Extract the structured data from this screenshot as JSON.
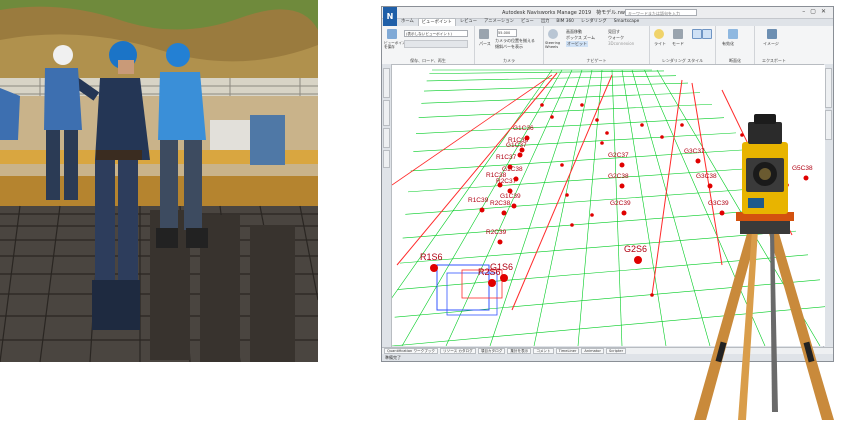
{
  "window": {
    "title": "Autodesk Navisworks Manage 2019　荷モデル.nwd",
    "search_placeholder": "キーワードまたは語句を入力",
    "app_button": "N"
  },
  "tabs": [
    "ホーム",
    "ビューポイント",
    "レビュー",
    "アニメーション",
    "ビュー",
    "出力",
    "BIM 360",
    "レンダリング",
    "Smartscape"
  ],
  "active_tab": "ビューポイント",
  "ribbon": {
    "groups": [
      {
        "id": "save-load",
        "label": "保存、ロード、再生"
      },
      {
        "id": "camera",
        "label": "カメラ"
      },
      {
        "id": "navigate",
        "label": "ナビゲート"
      },
      {
        "id": "render",
        "label": "レンダリング スタイル"
      },
      {
        "id": "section",
        "label": "断面化"
      },
      {
        "id": "export",
        "label": "エクスポート"
      }
    ],
    "save_viewpoint_label": "ビューポイント\nを保存",
    "viewpoint_dropdown": "(表示しないビューポイント)",
    "ortho_label": "パース",
    "fov_value": "55.000",
    "steering_label": "Steering\nWheels",
    "pan_label": "画面移動",
    "zoom_label": "ボックス ズーム",
    "orbit_label": "オービット",
    "lookaround_label": "見回す",
    "walk_label": "ウォーク",
    "realism_label": "3Dconnexion",
    "lighting_label": "ライト",
    "mode_label": "モード",
    "section_enable_label": "有効化",
    "image_label": "イメージ",
    "align_label": "カメラの位置を揃える",
    "straighten_label": "傾斜バーを表示"
  },
  "bottom_tabs": [
    "Quantification ワークブック",
    "リソース カタログ",
    "項目カタログ",
    "集計を表示",
    "コメント",
    "TimeLiner",
    "Animator",
    "Scripter"
  ],
  "status": "準備完了",
  "viewport_labels": [
    "R1C36",
    "R1C37",
    "R1C38",
    "R1C39",
    "R1S6",
    "R2C37",
    "R2C38",
    "R2C39",
    "R2S6",
    "G1C36",
    "G1C37",
    "G1C38",
    "G1C39",
    "G1S6",
    "G2C37",
    "G2C38",
    "G2C39",
    "G2S6",
    "G3C37",
    "G3C38",
    "G3C39",
    "G5C38"
  ],
  "colors": {
    "rebar_grid": "#00cc22",
    "beam": "#ff2a2a",
    "cage": "#3355ff",
    "survey_point": "#e00000",
    "label": "#b00012",
    "station_body": "#e8b400",
    "tripod_leg": "#c98a3b"
  }
}
